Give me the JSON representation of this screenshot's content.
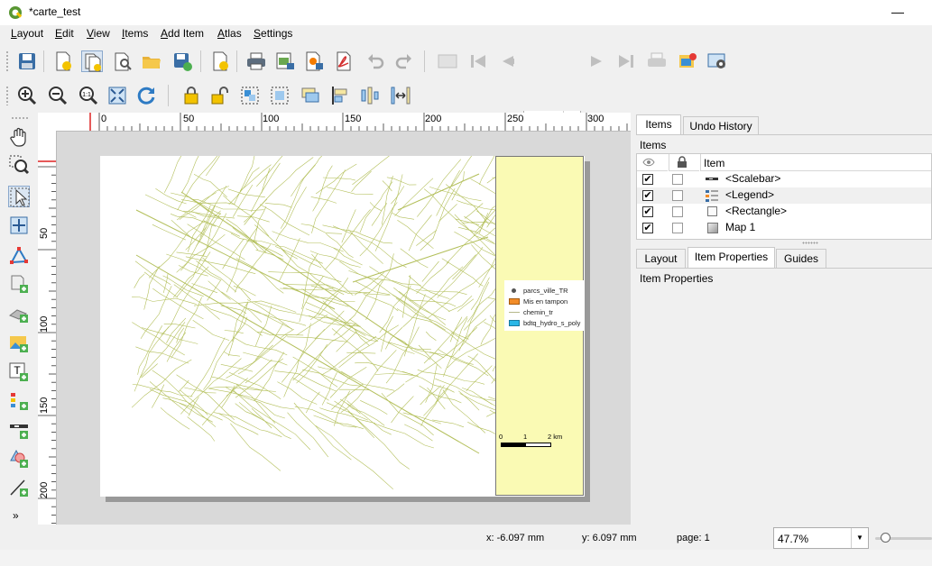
{
  "window": {
    "title": "*carte_test",
    "minimize_glyph": "—"
  },
  "menu": [
    "Layout",
    "Edit",
    "View",
    "Items",
    "Add Item",
    "Atlas",
    "Settings"
  ],
  "toolbar": {
    "page_spinner_value": "1"
  },
  "ruler": {
    "top_labels": [
      "0",
      "50",
      "100",
      "150",
      "200",
      "250",
      "300"
    ],
    "left_labels": [
      "50",
      "100",
      "150",
      "200"
    ]
  },
  "legend": {
    "entries": [
      {
        "label": "parcs_ville_TR",
        "color": "#555555",
        "symbol": "point"
      },
      {
        "label": "Mis en tampon",
        "color": "#f28c28",
        "symbol": "fill"
      },
      {
        "label": "chemin_tr",
        "color": "#b5b88a",
        "symbol": "line"
      },
      {
        "label": "bdtq_hydro_s_poly",
        "color": "#29b6e6",
        "symbol": "fill"
      }
    ]
  },
  "scalebar": {
    "labels": [
      "0",
      "1",
      "2 km"
    ]
  },
  "colors": {
    "map_lines": "#b3bf5a",
    "side_panel": "#fafab4",
    "canvas": "#d9d9d9"
  },
  "panel_top": {
    "tabs": [
      "Items",
      "Undo History"
    ],
    "heading": "Items",
    "column_item": "Item",
    "items": [
      {
        "label": "<Scalebar>",
        "visible": true,
        "locked": false,
        "icon": "scalebar-icon"
      },
      {
        "label": "<Legend>",
        "visible": true,
        "locked": false,
        "icon": "legend-icon"
      },
      {
        "label": "<Rectangle>",
        "visible": true,
        "locked": false,
        "icon": "rectangle-icon"
      },
      {
        "label": "Map 1",
        "visible": true,
        "locked": false,
        "icon": "map-icon"
      }
    ]
  },
  "panel_bottom": {
    "tabs": [
      "Layout",
      "Item Properties",
      "Guides"
    ],
    "heading": "Item Properties"
  },
  "status": {
    "x": "x: -6.097 mm",
    "y": "y: 6.097 mm",
    "page": "page: 1",
    "zoom": "47.7%"
  }
}
